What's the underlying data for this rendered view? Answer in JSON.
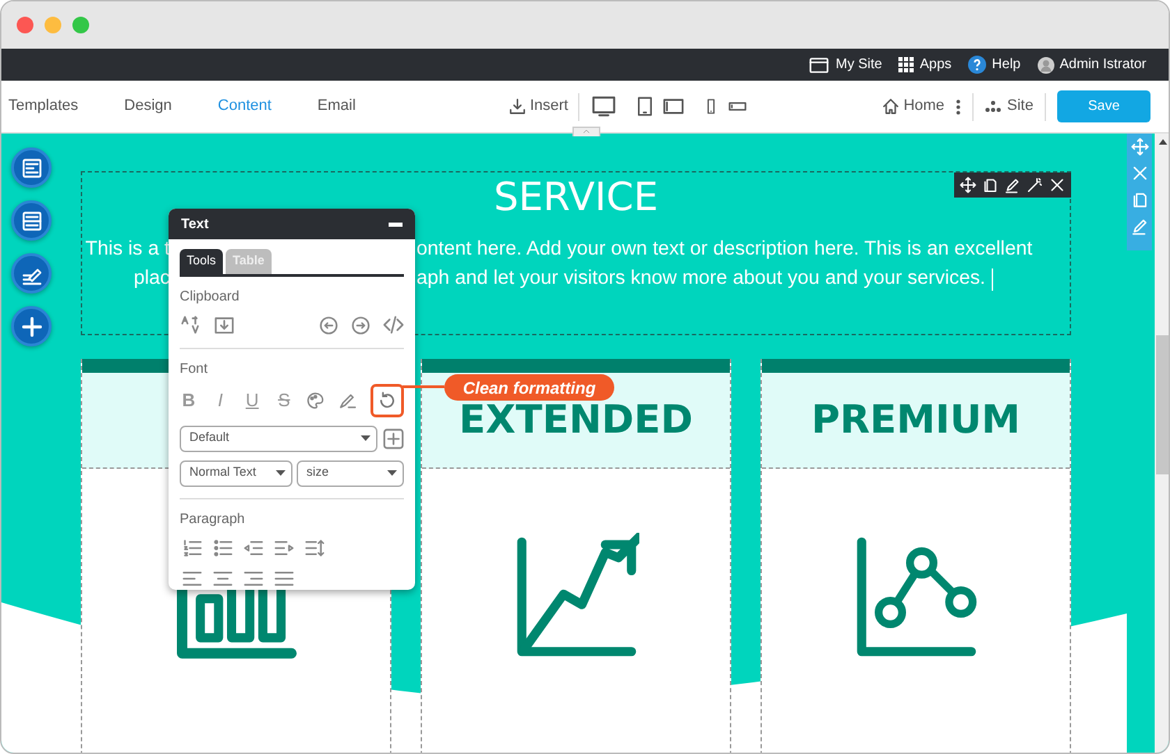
{
  "window": {
    "controls": [
      {
        "color": "#fc5753"
      },
      {
        "color": "#fdbc40"
      },
      {
        "color": "#33c748"
      }
    ]
  },
  "top_bar": {
    "items": [
      {
        "kind": "site",
        "label": "My Site"
      },
      {
        "kind": "apps",
        "label": "Apps"
      },
      {
        "kind": "help",
        "label": "Help"
      },
      {
        "kind": "user",
        "label": "Admin Istrator"
      }
    ]
  },
  "nav": {
    "tabs": [
      {
        "label": "Templates",
        "selected": false
      },
      {
        "label": "Design",
        "selected": false
      },
      {
        "label": "Content",
        "selected": true
      },
      {
        "label": "Email",
        "selected": false
      }
    ],
    "insert": "Insert",
    "page": "Home",
    "site": "Site",
    "save": "Save"
  },
  "hero": {
    "title": "SERVICE",
    "lines": [
      {
        "left": "This is a t",
        "right": "ontent here. Add your own text or description here. This is an excellent"
      },
      {
        "left": "plac",
        "right": "aph and let your visitors know more about you and your services."
      }
    ]
  },
  "cards": [
    {
      "kind": "bars"
    },
    {
      "kind": "growth",
      "title": "EXTENDED"
    },
    {
      "kind": "nodes",
      "title": "PREMIUM"
    }
  ],
  "text_panel": {
    "title": "Text",
    "tabs": [
      {
        "label": "Tools",
        "selected": true
      },
      {
        "label": "Table",
        "selected": false
      }
    ],
    "clipboard": "Clipboard",
    "font": "Font",
    "font_buttons": [
      {
        "kind": "bold",
        "label": "B"
      },
      {
        "kind": "italic",
        "label": "I"
      },
      {
        "kind": "underline",
        "label": "U"
      },
      {
        "kind": "strike",
        "label": "S"
      }
    ],
    "font_family": "Default",
    "block_style": "Normal Text",
    "size": "size",
    "paragraph": "Paragraph"
  },
  "callout": {
    "label": "Clean formatting"
  }
}
